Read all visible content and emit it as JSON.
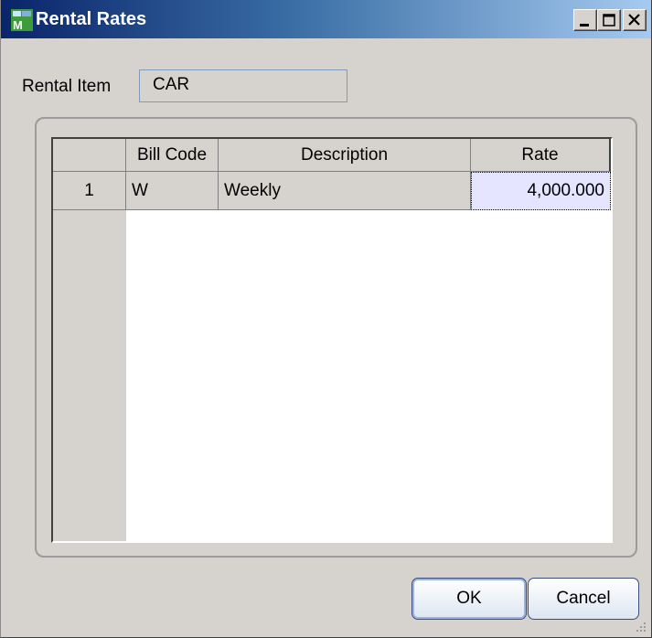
{
  "window": {
    "title": "Rental Rates",
    "app_icon": "mas-app-icon"
  },
  "titlebar_buttons": [
    "minimize-icon",
    "maximize-icon",
    "close-icon"
  ],
  "rental_item": {
    "label": "Rental Item",
    "value": "CAR"
  },
  "grid": {
    "columns": [
      "Bill Code",
      "Description",
      "Rate"
    ],
    "rows": [
      {
        "num": "1",
        "bill_code": "W",
        "description": "Weekly",
        "rate": "4,000.000"
      }
    ]
  },
  "buttons": {
    "ok": "OK",
    "cancel": "Cancel"
  },
  "colors": {
    "title_start": "#0a246a",
    "title_end": "#a6caf0",
    "selected_cell": "#e5e5ff",
    "dialog_bg": "#d6d3ce"
  }
}
